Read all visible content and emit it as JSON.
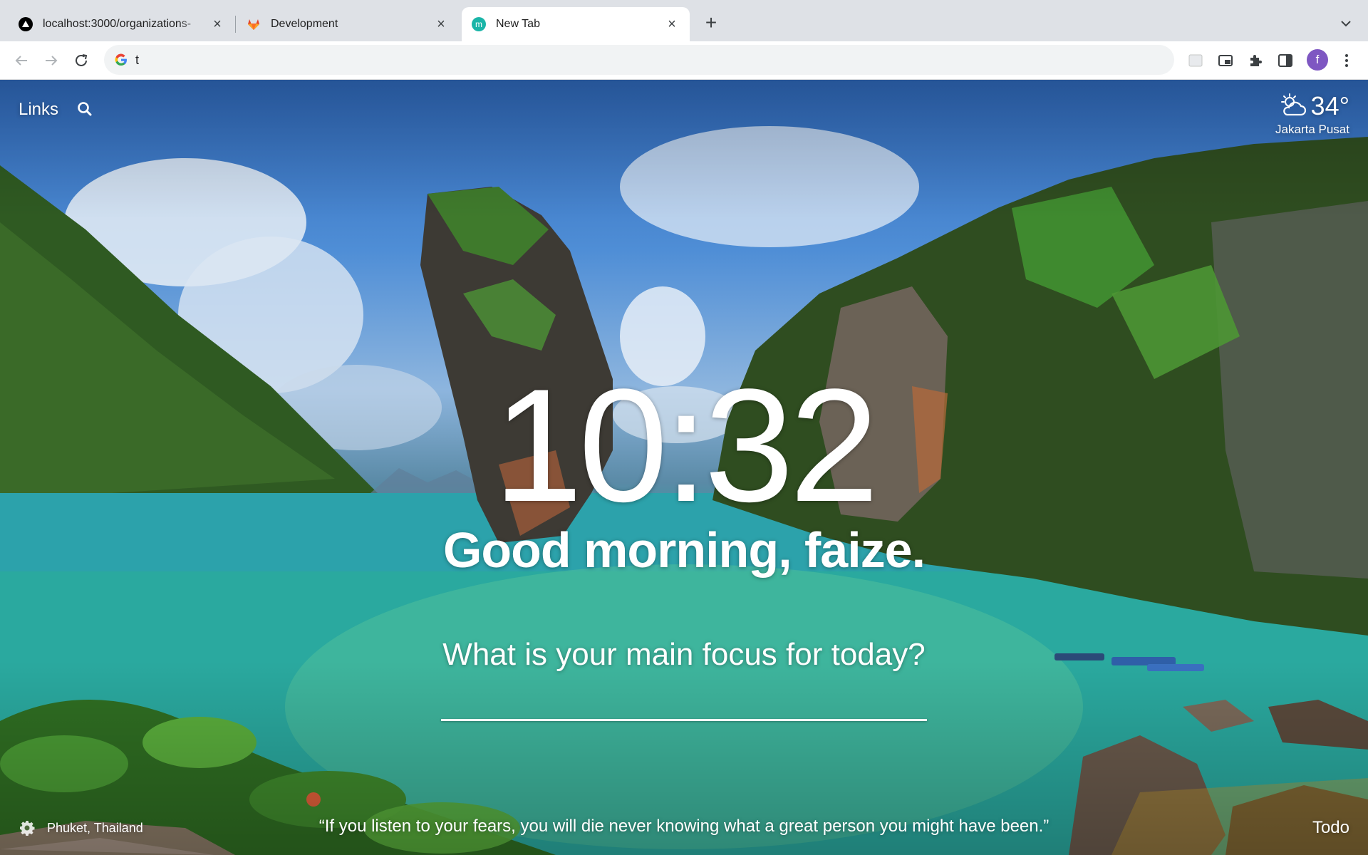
{
  "browser": {
    "tabs": [
      {
        "title": "localhost:3000/organizations-",
        "favicon": "nextjs-icon"
      },
      {
        "title": "Development",
        "favicon": "gitlab-icon"
      },
      {
        "title": "New Tab",
        "favicon": "momentum-icon",
        "favicon_letter": "m",
        "active": true
      }
    ],
    "new_tab_glyph": "+",
    "close_glyph": "×",
    "address": {
      "value": "t"
    },
    "profile_initial": "f"
  },
  "newtab": {
    "links_label": "Links",
    "weather": {
      "temperature": "34°",
      "location": "Jakarta Pusat",
      "icon": "partly-cloudy-icon"
    },
    "clock": "10:32",
    "greeting": "Good morning, faize.",
    "focus_question": "What is your main focus for today?",
    "photo_location": "Phuket, Thailand",
    "quote": "“If you listen to your fears, you will die never knowing what a great person you might have been.”",
    "todo_label": "Todo"
  },
  "colors": {
    "tabstrip_bg": "#dee1e6",
    "omnibox_bg": "#f1f3f4",
    "profile_bg": "#7e57c2",
    "momentum_teal": "#1ab5a8"
  }
}
